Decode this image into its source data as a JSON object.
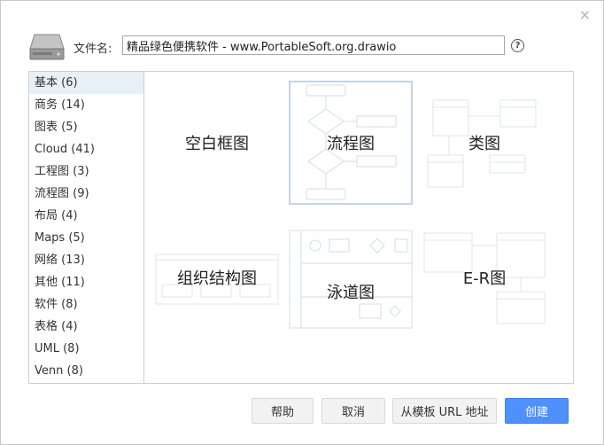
{
  "dialog": {
    "close_label": "×",
    "filename_label": "文件名:",
    "filename_value": "精品绿色便携软件 - www.PortableSoft.org.drawio",
    "help_label": "?"
  },
  "categories": [
    {
      "label": "基本 (6)",
      "selected": true
    },
    {
      "label": "商务 (14)"
    },
    {
      "label": "图表 (5)"
    },
    {
      "label": "Cloud (41)"
    },
    {
      "label": "工程图 (3)"
    },
    {
      "label": "流程图 (9)"
    },
    {
      "label": "布局 (4)"
    },
    {
      "label": "Maps (5)"
    },
    {
      "label": "网络 (13)"
    },
    {
      "label": "其他 (11)"
    },
    {
      "label": "软件 (8)"
    },
    {
      "label": "表格 (4)"
    },
    {
      "label": "UML (8)"
    },
    {
      "label": "Venn (8)"
    }
  ],
  "templates": [
    {
      "label": "空白框图",
      "selected": false
    },
    {
      "label": "流程图",
      "selected": true
    },
    {
      "label": "类图",
      "selected": false
    },
    {
      "label": "组织结构图",
      "selected": false
    },
    {
      "label": "泳道图",
      "selected": false
    },
    {
      "label": "E-R图",
      "selected": false
    }
  ],
  "buttons": {
    "help": "帮助",
    "cancel": "取消",
    "from_url": "从模板 URL 地址",
    "create": "创建"
  },
  "colors": {
    "accent": "#4d90fe",
    "selected_category_bg": "#e8f0f7",
    "selected_tile_border": "#c2d4e8"
  }
}
